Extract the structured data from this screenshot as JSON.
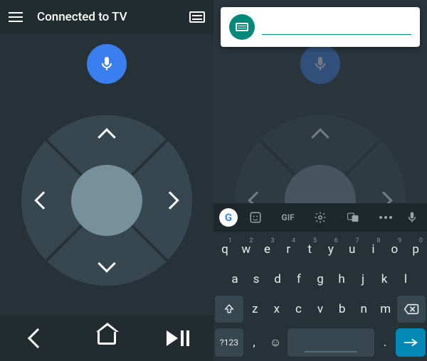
{
  "left": {
    "title": "Connected to TV",
    "nav": {
      "back": "back",
      "home": "home",
      "playpause": "play-pause"
    },
    "mic": "voice-search"
  },
  "right": {
    "input_placeholder": "",
    "toolbar": {
      "google": "G",
      "sticker": "sticker",
      "gif": "GIF",
      "settings": "settings",
      "translate": "translate",
      "more": "more",
      "mic": "mic"
    },
    "keys": {
      "row1": [
        {
          "k": "q",
          "n": "1"
        },
        {
          "k": "w",
          "n": "2"
        },
        {
          "k": "e",
          "n": "3"
        },
        {
          "k": "r",
          "n": "4"
        },
        {
          "k": "t",
          "n": "5"
        },
        {
          "k": "y",
          "n": "6"
        },
        {
          "k": "u",
          "n": "7"
        },
        {
          "k": "i",
          "n": "8"
        },
        {
          "k": "o",
          "n": "9"
        },
        {
          "k": "p",
          "n": "0"
        }
      ],
      "row2": [
        "a",
        "s",
        "d",
        "f",
        "g",
        "h",
        "j",
        "k",
        "l"
      ],
      "row3": [
        "z",
        "x",
        "c",
        "v",
        "b",
        "n",
        "m"
      ],
      "symbols": "?123",
      "comma": ",",
      "period": "."
    }
  }
}
